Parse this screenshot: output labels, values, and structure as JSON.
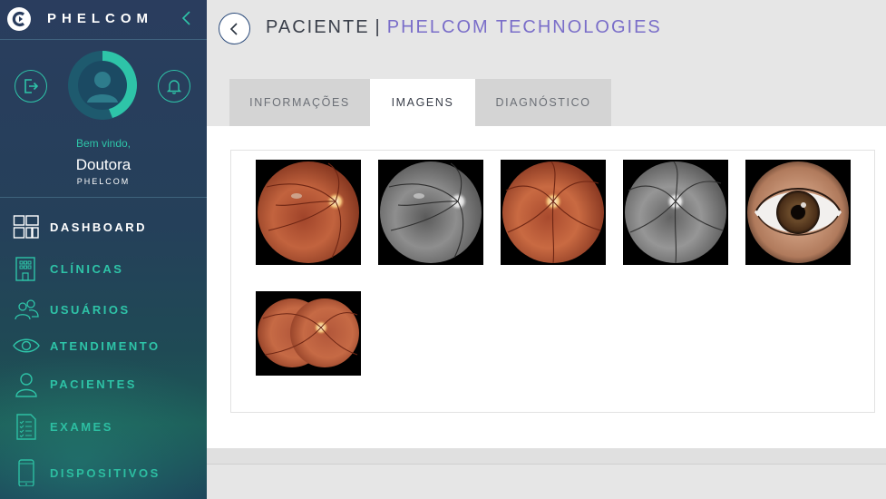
{
  "brand": {
    "name": "PHELCOM",
    "collapse_icon": "chevron-left-icon"
  },
  "profile": {
    "welcome": "Bem vindo,",
    "name": "Doutora",
    "org": "PHELCOM",
    "logout_icon": "logout-icon",
    "bell_icon": "bell-icon",
    "avatar_icon": "avatar-icon"
  },
  "nav": {
    "items": [
      {
        "label": "DASHBOARD",
        "icon": "dashboard-icon",
        "active": true
      },
      {
        "label": "CLÍNICAS",
        "icon": "building-icon"
      },
      {
        "label": "USUÁRIOS",
        "icon": "users-icon"
      },
      {
        "label": "ATENDIMENTO",
        "icon": "eye-icon"
      },
      {
        "label": "PACIENTES",
        "icon": "user-icon"
      },
      {
        "label": "EXAMES",
        "icon": "checklist-icon"
      },
      {
        "label": "DISPOSITIVOS",
        "icon": "tablet-icon"
      }
    ]
  },
  "header": {
    "title": "PACIENTE",
    "separator": "|",
    "org": "PHELCOM TECHNOLOGIES",
    "back_icon": "chevron-left-icon"
  },
  "tabs": [
    {
      "label": "INFORMAÇÕES",
      "active": false
    },
    {
      "label": "IMAGENS",
      "active": true
    },
    {
      "label": "DIAGNÓSTICO",
      "active": false
    }
  ],
  "gallery": {
    "images": [
      {
        "kind": "retina-color"
      },
      {
        "kind": "retina-red-free"
      },
      {
        "kind": "retina-color"
      },
      {
        "kind": "retina-red-free"
      },
      {
        "kind": "anterior-eye"
      },
      {
        "kind": "retina-panorama"
      }
    ]
  },
  "colors": {
    "accent": "#2ec4a8",
    "title_org": "#7a6ec9",
    "sidebar_top": "#2a3d5e",
    "sidebar_bottom": "#1d5a57"
  }
}
